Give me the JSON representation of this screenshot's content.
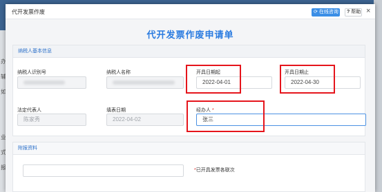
{
  "background": {
    "nav_fragments": [
      "办",
      "辅",
      "如",
      "业",
      "式",
      "报"
    ],
    "bottom_text": "..."
  },
  "modal": {
    "title": "代开发票作废",
    "online_button": "在线咨询",
    "help_button": "帮助",
    "close_glyph": "×"
  },
  "form": {
    "title": "代开发票作废申请单",
    "section_basic": {
      "heading": "纳税人基本信息",
      "taxpayer_id_label": "纳税人识别号",
      "taxpayer_name_label": "纳税人名称",
      "start_date_label": "开具日期起",
      "start_date_value": "2022-04-01",
      "end_date_label": "开具日期止",
      "end_date_value": "2022-04-30",
      "legal_rep_label": "法定代表人",
      "legal_rep_value": "陈家秀",
      "fill_date_label": "填表日期",
      "fill_date_value": "2022-04-02",
      "handler_label": "经办人",
      "required_mark": "*",
      "handler_value": "张三"
    },
    "section_attach": {
      "heading": "附报资料",
      "required_mark": "*",
      "issued_invoice_note": "已开具发票各联次"
    }
  },
  "colors": {
    "accent": "#2a7be0",
    "highlight": "#e5141b",
    "required": "#e0302d"
  }
}
